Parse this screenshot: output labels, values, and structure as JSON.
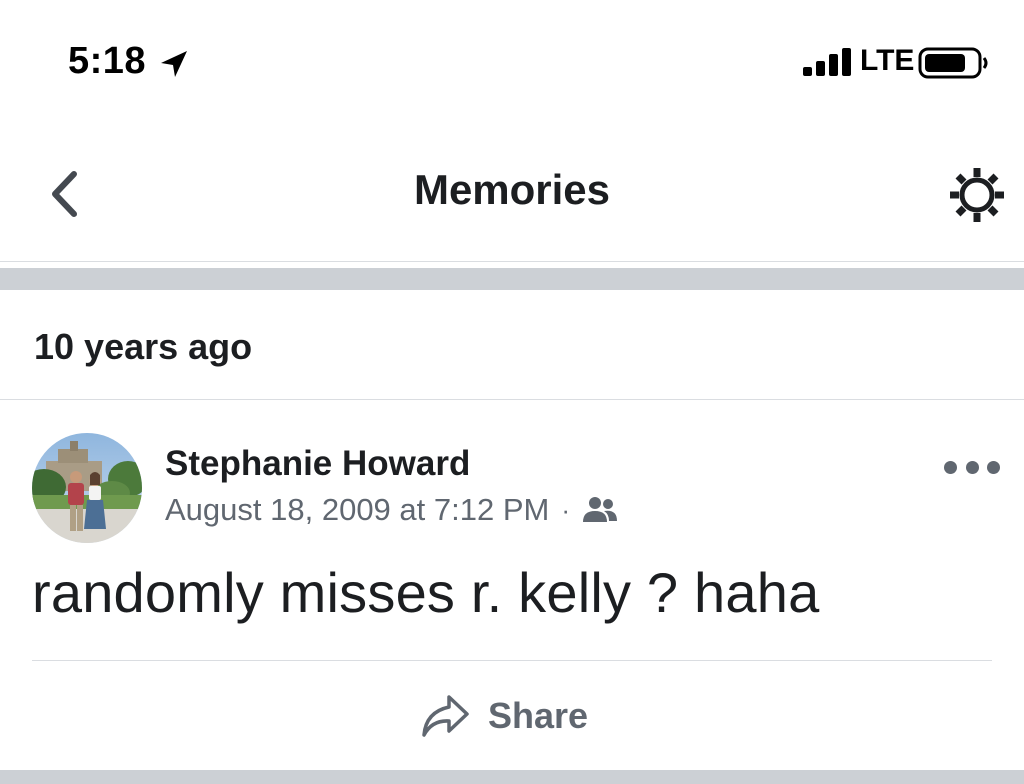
{
  "status_bar": {
    "time": "5:18",
    "carrier": "LTE",
    "icons": [
      "location-arrow-icon",
      "cellular-signal-icon",
      "battery-icon"
    ]
  },
  "nav": {
    "title": "Memories",
    "back_icon": "chevron-left-icon",
    "settings_icon": "gear-icon"
  },
  "section": {
    "title": "10 years ago"
  },
  "post": {
    "author": "Stephanie Howard",
    "timestamp": "August 18, 2009 at 7:12 PM",
    "separator": "·",
    "audience_icon": "friends-icon",
    "text": "randomly misses r. kelly ? haha",
    "more_icon": "more-horizontal-icon",
    "share_label": "Share",
    "share_icon": "share-arrow-icon"
  },
  "colors": {
    "text_primary": "#1c1e21",
    "text_secondary": "#606770",
    "divider": "#dadde1",
    "separator_band": "#ccd0d5"
  }
}
